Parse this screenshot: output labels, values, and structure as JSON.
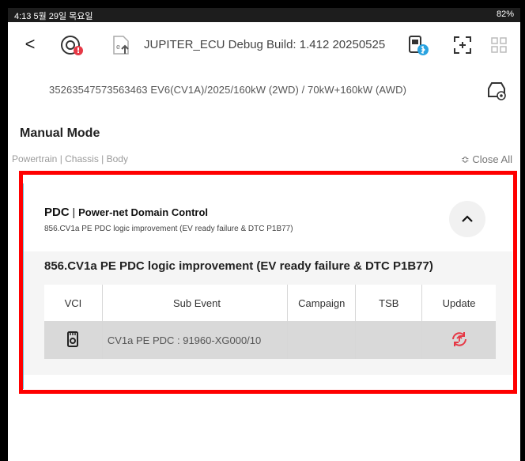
{
  "status_bar": {
    "left": "4:13  5월 29일 목요일",
    "right": "82%"
  },
  "topbar": {
    "title": "JUPITER_ECU Debug Build: 1.412 20250525",
    "back_glyph": "<",
    "icons": [
      "back-arrow-icon",
      "firmware-update-icon",
      "upload-file-icon",
      "ecu-bluetooth-icon",
      "expand-icon",
      "grid-icon"
    ]
  },
  "vehicle": {
    "info": "35263547573563463  EV6(CV1A)/2025/160kW (2WD) / 70kW+160kW (AWD)"
  },
  "manual_mode": {
    "title": "Manual Mode",
    "tabs": "Powertrain  |  Chassis  |  Body",
    "close_all": "≎ Close All"
  },
  "card": {
    "code": "PDC",
    "separator": " | ",
    "name": "Power-net Domain Control",
    "subtitle": "856.CV1a PE PDC logic improvement (EV ready failure & DTC P1B77)",
    "body_title": "856.CV1a PE PDC logic improvement (EV ready failure & DTC P1B77)",
    "table": {
      "headers": [
        "VCI",
        "Sub Event",
        "Campaign",
        "TSB",
        "Update"
      ],
      "rows": [
        {
          "vci": "",
          "sub_event": "CV1a PE PDC : 91960-XG000/10",
          "campaign": "",
          "tsb": "",
          "update": ""
        }
      ]
    }
  },
  "colors": {
    "accent_bar": "#66c8e2",
    "update_red": "#e63946",
    "highlight_box": "#ff0000"
  }
}
